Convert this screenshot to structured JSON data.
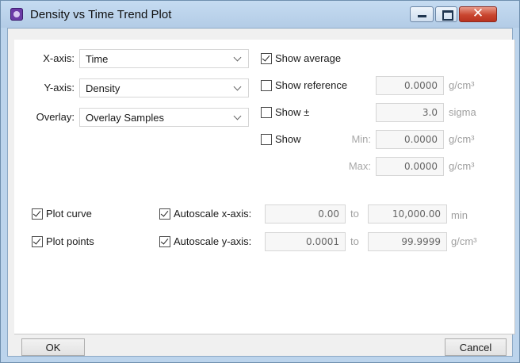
{
  "window": {
    "title": "Density vs Time Trend Plot",
    "controls": [
      "minimize-icon",
      "maximize-icon",
      "close-icon"
    ]
  },
  "axes": {
    "x_label": "X-axis:",
    "x_value": "Time",
    "y_label": "Y-axis:",
    "y_value": "Density",
    "overlay_label": "Overlay:",
    "overlay_value": "Overlay Samples"
  },
  "display": {
    "show_average": {
      "label": "Show average",
      "checked": true
    },
    "show_reference": {
      "label": "Show reference",
      "checked": false,
      "value": "0.0000",
      "unit": "g/cm³"
    },
    "show_pm": {
      "label": "Show ±",
      "checked": false,
      "value": "3.0",
      "unit": "sigma"
    },
    "show": {
      "label": "Show",
      "checked": false,
      "min_label": "Min:",
      "min_value": "0.0000",
      "min_unit": "g/cm³",
      "max_label": "Max:",
      "max_value": "0.0000",
      "max_unit": "g/cm³"
    }
  },
  "plot": {
    "plot_curve": {
      "label": "Plot curve",
      "checked": true
    },
    "plot_points": {
      "label": "Plot points",
      "checked": true
    },
    "autoscale_x": {
      "label": "Autoscale x-axis:",
      "checked": true,
      "from": "0.00",
      "to_label": "to",
      "to": "10,000.00",
      "unit": "min"
    },
    "autoscale_y": {
      "label": "Autoscale y-axis:",
      "checked": true,
      "from": "0.0001",
      "to_label": "to",
      "to": "99.9999",
      "unit": "g/cm³"
    }
  },
  "buttons": {
    "ok": "OK",
    "cancel": "Cancel"
  }
}
